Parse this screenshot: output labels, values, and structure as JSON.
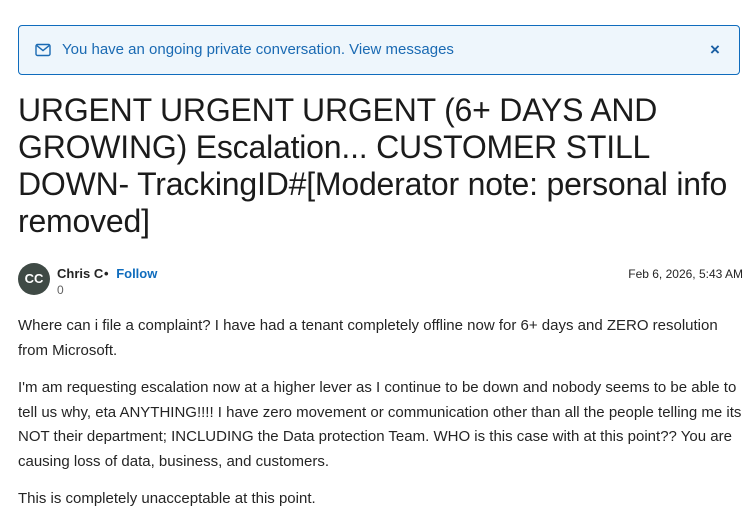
{
  "banner": {
    "icon": "mail-icon",
    "message": "You have an ongoing private conversation. View messages",
    "close_label": "×",
    "border_color": "#0f6cbd",
    "background_color": "#eef6fc"
  },
  "post": {
    "title": "URGENT URGENT URGENT (6+ DAYS AND GROWING) Escalation... CUSTOMER STILL DOWN- TrackingID#[Moderator note: personal info removed]",
    "author": {
      "initials": "CC",
      "name": "Chris C",
      "separator": "•",
      "follow_label": "Follow",
      "kudos": "0"
    },
    "date": "Feb 6, 2026, 5:43 AM",
    "paragraphs": [
      "Where can i file a complaint? I have had a tenant completely offline now for 6+ days and ZERO resolution from Microsoft.",
      "I'm am requesting escalation now at a higher lever as I continue to be down and nobody seems to be able to tell us why, eta ANYTHING!!!!  I have zero movement or communication other than all the people telling me its NOT their department; INCLUDING the Data protection Team.  WHO is this case with at this point?? You are causing loss of data, business, and customers.",
      "This is completely unacceptable at this point."
    ]
  },
  "colors": {
    "link": "#0f6cbd",
    "avatar_bg": "#3f4a45"
  }
}
